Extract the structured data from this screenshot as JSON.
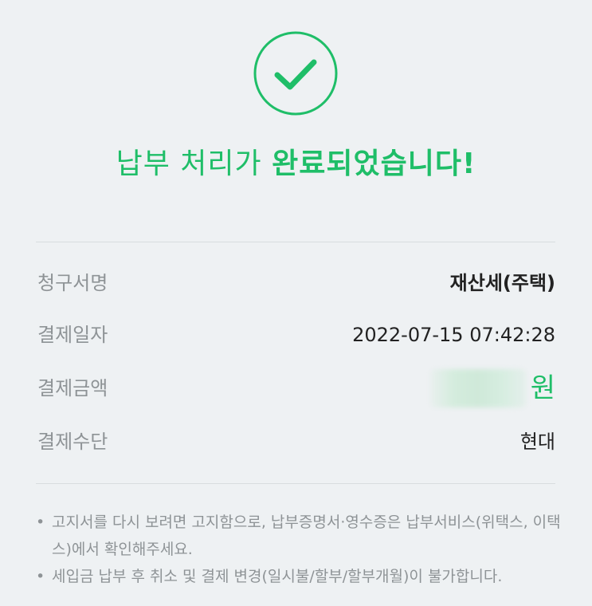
{
  "status": {
    "icon": "check-circle-icon",
    "headline_normal": "납부 처리가 ",
    "headline_bold": "완료되었습니다!"
  },
  "details": [
    {
      "label": "청구서명",
      "value": "재산세(주택)"
    },
    {
      "label": "결제일자",
      "value": "2022-07-15 07:42:28"
    },
    {
      "label": "결제금액",
      "value_unit": "원"
    },
    {
      "label": "결제수단",
      "value": "현대"
    }
  ],
  "notes": [
    "고지서를 다시 보려면 고지함으로, 납부증명서·영수증은 납부서비스(위택스, 이택스)에서 확인해주세요.",
    "세입금 납부 후 취소 및 결제 변경(일시불/할부/할부개월)이 불가합니다."
  ],
  "colors": {
    "accent": "#1fbe68",
    "background": "#eef1f3",
    "label": "#8e9396",
    "value": "#222222"
  }
}
